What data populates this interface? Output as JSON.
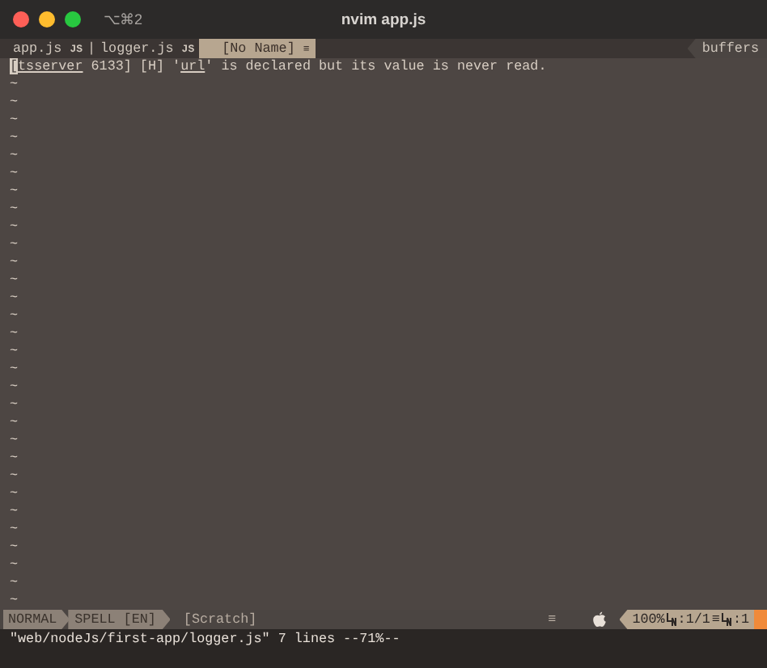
{
  "window": {
    "title": "nvim app.js",
    "shortcut": "⌥⌘2"
  },
  "tabline": {
    "tabs": [
      {
        "label": "app.js",
        "icon": "JS",
        "selected": false,
        "separator": "|"
      },
      {
        "label": "logger.js",
        "icon": "JS",
        "selected": false
      },
      {
        "label": "[No Name]",
        "icon": "≡",
        "selected": true
      }
    ],
    "right": "buffers"
  },
  "editor": {
    "message": [
      {
        "text": "[",
        "cursor": true,
        "underline": false
      },
      {
        "text": "tsserver",
        "cursor": false,
        "underline": true
      },
      {
        "text": " 6133] [H] '",
        "cursor": false,
        "underline": false
      },
      {
        "text": "url",
        "cursor": false,
        "underline": true
      },
      {
        "text": "' is declared but its value is never read.",
        "cursor": false,
        "underline": false
      }
    ],
    "empty_lines": [
      "~",
      "~",
      "~",
      "~",
      "~",
      "~",
      "~",
      "~",
      "~",
      "~",
      "~",
      "~",
      "~",
      "~",
      "~",
      "~",
      "~",
      "~",
      "~",
      "~",
      "~",
      "~",
      "~",
      "~",
      "~",
      "~",
      "~",
      "~",
      "~",
      "~"
    ]
  },
  "statusline": {
    "mode": "NORMAL",
    "spell": "SPELL [EN]",
    "buffer": "[Scratch]",
    "filetype_icon": "≡",
    "percent": "100%",
    "line": ":1/1",
    "line_icon": "≡",
    "column": ":1"
  },
  "command_line": "\"web/nodeJs/first-app/logger.js\" 7 lines --71%--"
}
